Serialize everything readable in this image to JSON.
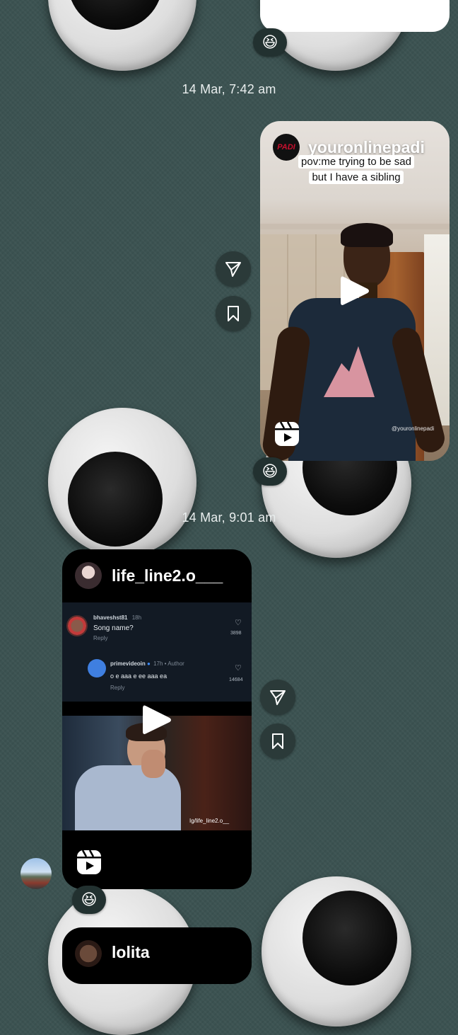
{
  "messages": [
    {
      "timestamp": "14 Mar, 7:42 am",
      "reel": {
        "account": "youronlinepadi",
        "account_logo_text": "PADI",
        "caption_lines": [
          "pov:me trying to be sad",
          "but I have a sibling"
        ],
        "watermark": "@youronlinepadi"
      },
      "reaction": "😆"
    },
    {
      "timestamp": "14 Mar, 9:01 am",
      "reel": {
        "account": "life_line2.o___",
        "comments": [
          {
            "user": "bhaveshst81",
            "age": "18h",
            "text": "Song name?",
            "reply": "Reply",
            "likes": "3898"
          },
          {
            "user": "primevideoin",
            "age": "17h • Author",
            "text": "o e aaa e ee aaa ea",
            "reply": "Reply",
            "likes": "14684"
          }
        ],
        "watermark": "Ig/life_line2.o__"
      },
      "reaction": "😆"
    }
  ],
  "top_reaction": "😆",
  "next_reel_account": "lolita",
  "icons": {
    "share": "paper-plane-icon",
    "save": "bookmark-icon",
    "reel": "reels-icon",
    "play": "play-icon"
  },
  "colors": {
    "background": "#3c5352",
    "bubble_dark": "#000000",
    "logo_red": "#c8102e"
  }
}
